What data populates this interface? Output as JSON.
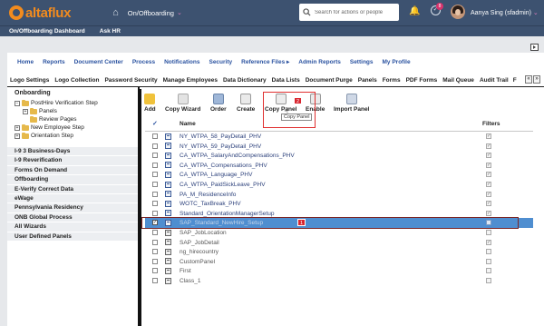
{
  "topbar": {
    "logo_text": "altaflux",
    "module": "On/Offboarding",
    "search_placeholder": "Search for actions or people",
    "notification_count": "8",
    "user_name": "Aanya Sing (sfadmin)"
  },
  "subbar": {
    "items": [
      "On/Offboarding Dashboard",
      "Ask HR"
    ]
  },
  "main_nav": [
    "Home",
    "Reports",
    "Document Center",
    "Process",
    "Notifications",
    "Security",
    "Reference Files ▸",
    "Admin Reports",
    "Settings",
    "My Profile"
  ],
  "tabs": [
    "Logo Settings",
    "Logo Collection",
    "Password Security",
    "Manage Employees",
    "Data Dictionary",
    "Data Lists",
    "Document Purge",
    "Panels",
    "Forms",
    "PDF Forms",
    "Mail Queue",
    "Audit Trail",
    "F"
  ],
  "tab_arrows": [
    "«",
    "»"
  ],
  "tree": {
    "title": "Onboarding",
    "nodes": [
      {
        "label": "PostHire Verification Step",
        "toggle": "−"
      },
      {
        "label": "Panels",
        "toggle": "+"
      },
      {
        "label": "Review Pages",
        "toggle": ""
      },
      {
        "label": "New Employee Step",
        "toggle": "+"
      },
      {
        "label": "Orientation Step",
        "toggle": "+"
      }
    ],
    "groups": [
      "I-9 3 Business-Days",
      "I-9 Reverification",
      "Forms On Demand",
      "Offboarding",
      "E-Verify Correct Data",
      "eWage",
      "Pennsylvania Residency",
      "ONB Global Process",
      "All Wizards",
      "User Defined Panels"
    ]
  },
  "toolbar": {
    "buttons": [
      "Add",
      "Copy Wizard",
      "Order",
      "Create",
      "Copy Panel",
      "Enable",
      "Import Panel"
    ],
    "tooltip": "Copy Panel",
    "callout_2": "2",
    "callout_1": "1"
  },
  "table": {
    "col_check": "✓",
    "col_name": "Name",
    "col_filters": "Filters",
    "rows": [
      {
        "name": "NY_WTPA_58_PayDetail_PHV",
        "checked": "",
        "filter": "✓"
      },
      {
        "name": "NY_WTPA_59_PayDetail_PHV",
        "checked": "",
        "filter": "✓"
      },
      {
        "name": "CA_WTPA_SalaryAndCompensations_PHV",
        "checked": "",
        "filter": "✓"
      },
      {
        "name": "CA_WTPA_Compensations_PHV",
        "checked": "",
        "filter": "✓"
      },
      {
        "name": "CA_WTPA_Language_PHV",
        "checked": "",
        "filter": "✓"
      },
      {
        "name": "CA_WTPA_PaidSickLeave_PHV",
        "checked": "",
        "filter": "✓"
      },
      {
        "name": "PA_M_ResidenceInfo",
        "checked": "",
        "filter": "✓"
      },
      {
        "name": "WOTC_TaxBreak_PHV",
        "checked": "",
        "filter": "✓"
      },
      {
        "name": "Standard_OrientationManagerSetup",
        "checked": "",
        "filter": "✓"
      },
      {
        "name": "SAP_Standard_NewHire_Setup",
        "checked": "✓",
        "filter": ""
      },
      {
        "name": "SAP_JobLocation",
        "checked": "",
        "filter": ""
      },
      {
        "name": "SAP_JobDetail",
        "checked": "",
        "filter": "✓"
      },
      {
        "name": "ng_hirecountry",
        "checked": "",
        "filter": ""
      },
      {
        "name": "CustomPanel",
        "checked": "",
        "filter": ""
      },
      {
        "name": "First",
        "checked": "",
        "filter": ""
      },
      {
        "name": "Class_1",
        "checked": "",
        "filter": ""
      }
    ]
  },
  "colors": {
    "header_bg": "#3d5270",
    "brand_orange": "#f28b1e",
    "link_blue": "#2a52a0",
    "selected_row": "#4f8ed0",
    "callout_red": "#d9262f"
  }
}
